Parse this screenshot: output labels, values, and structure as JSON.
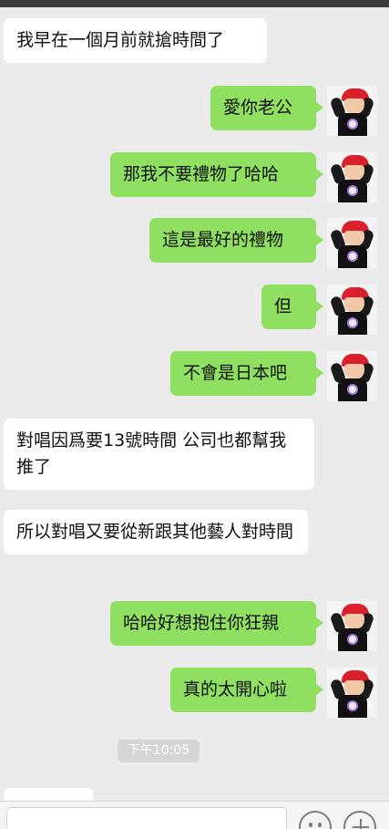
{
  "messages": [
    {
      "side": "in",
      "text": "我早在一個月前就搶時間了"
    },
    {
      "side": "out",
      "text": "愛你老公"
    },
    {
      "side": "out",
      "text": "那我不要禮物了哈哈"
    },
    {
      "side": "out",
      "text": "這是最好的禮物"
    },
    {
      "side": "out",
      "text": "但"
    },
    {
      "side": "out",
      "text": "不會是日本吧"
    },
    {
      "side": "in",
      "text": "對唱因爲要13號時間 公司也都幫我推了"
    },
    {
      "side": "in",
      "text": "所以對唱又要從新跟其他藝人對時間"
    },
    {
      "side": "out",
      "text": "哈哈好想抱住你狂親"
    },
    {
      "side": "out",
      "text": "真的太開心啦"
    }
  ],
  "timestamp": "下午10:05",
  "colors": {
    "outgoing_bubble": "#8fe060",
    "incoming_bubble": "#ffffff",
    "background": "#ebebeb"
  },
  "icons": {
    "emoji": "emoji-icon",
    "plus": "plus-icon"
  }
}
